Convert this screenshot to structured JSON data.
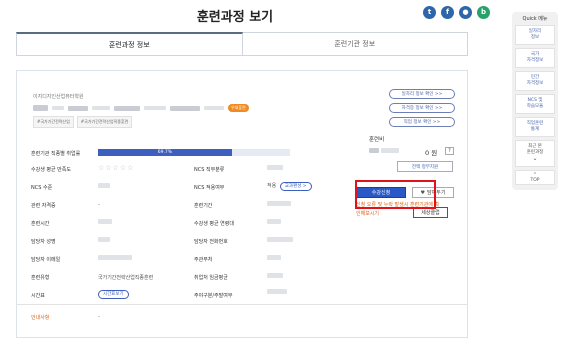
{
  "page": {
    "title": "훈련과정 보기"
  },
  "share": [
    {
      "name": "twitter-icon",
      "glyph": "t",
      "color": "#2d67a9"
    },
    {
      "name": "facebook-icon",
      "glyph": "f",
      "color": "#2d67a9"
    },
    {
      "name": "kakao-icon",
      "glyph": "●",
      "color": "#2d67a9"
    },
    {
      "name": "band-icon",
      "glyph": "b",
      "color": "#26a36b"
    }
  ],
  "tabs": [
    {
      "label": "훈련과정 정보"
    },
    {
      "label": "훈련기관 정보"
    }
  ],
  "course": {
    "institution": "이지디지인산업뷰터학원",
    "tag_orange": "우대훈련",
    "tags": [
      "#국가기간전략산업",
      "#국가기간전략산업직종훈련"
    ]
  },
  "right_buttons": [
    "일자리 정보 확인 >>",
    "자격증 정보 확인 >>",
    "직업 정보 확인 >>"
  ],
  "rate": {
    "label": "훈련기관 직종별 취업률",
    "value": "69.7%",
    "fraction": 0.697
  },
  "left_labels": [
    "수강생 평균 만족도",
    "NCS 수준",
    "관련 자격증",
    "훈련시간",
    "담당자 성명",
    "담당자 이메일",
    "훈련유형",
    "시간표"
  ],
  "right_labels": [
    "NCS 직무분류",
    "NCS 적용여부",
    "훈련기간",
    "수강생 평균 연령대",
    "담당자 전화번호",
    "주관부처",
    "취업처 임금평균",
    "주야구분/주말여부"
  ],
  "values": {
    "ncs_apply": "적용",
    "curriculum_button": "교과편성 >",
    "training_type": "국가기간전략산업직종훈련",
    "timetable_button": "시간표보기",
    "notice_label": "안내사항",
    "notice_value": "-"
  },
  "fee": {
    "label": "훈련비",
    "amount": "0 원",
    "help": "?",
    "support_button": "전액 정부지원"
  },
  "actions": {
    "apply": "수강신청",
    "wish": "담아두기",
    "tooltip": "세상클럽",
    "notice_line1": "신청 오류 및 누락 발생시 훈련기관에 확",
    "notice_line2": "인해보시기"
  },
  "side": {
    "title": "Quick 메뉴",
    "items": [
      "일자리\n정보",
      "국가\n자격정보",
      "민간\n자격정보",
      "NCS 및\n학습모듈",
      "직업훈련\n통계"
    ],
    "recent": "최근 본\n훈련과정",
    "top": "TOP"
  }
}
